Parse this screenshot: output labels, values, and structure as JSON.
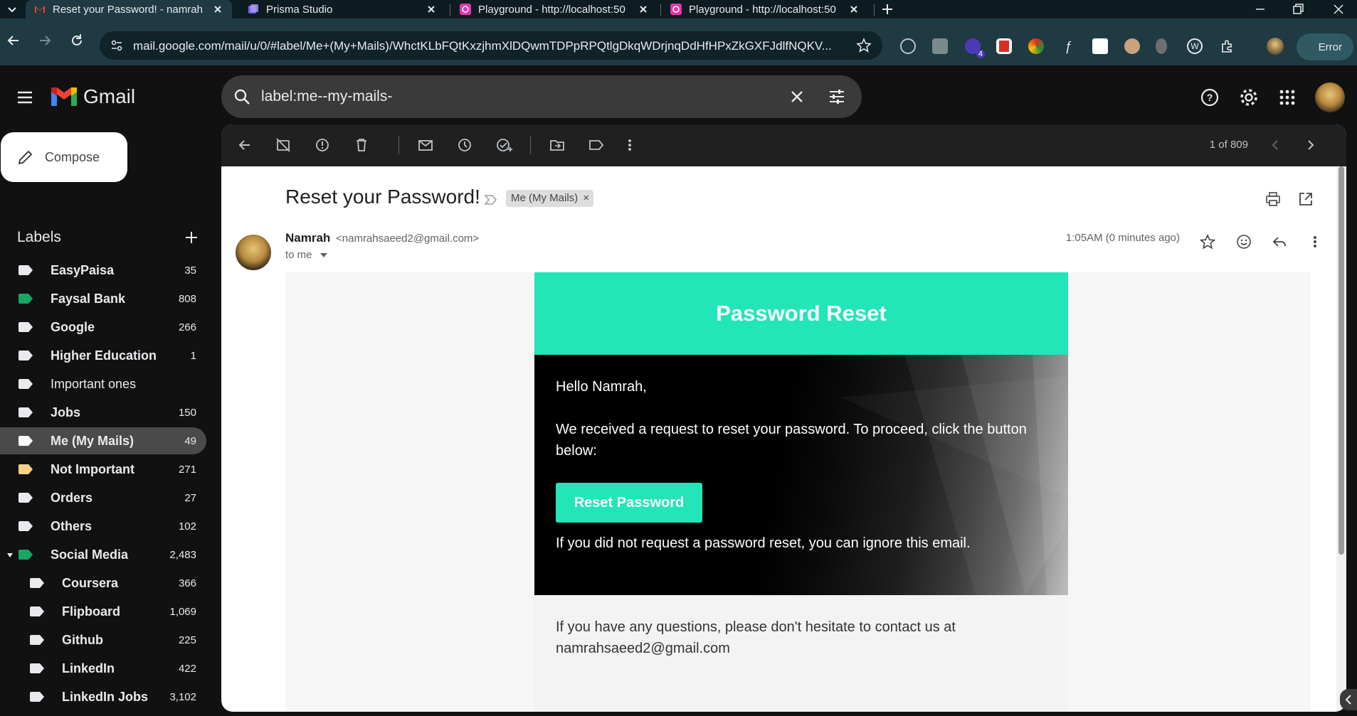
{
  "browser": {
    "tabs": [
      {
        "title": "Reset your Password! - namrah",
        "active": true
      },
      {
        "title": "Prisma Studio",
        "active": false
      },
      {
        "title": "Playground - http://localhost:50",
        "active": false
      },
      {
        "title": "Playground - http://localhost:50",
        "active": false
      }
    ],
    "url": "mail.google.com/mail/u/0/#label/Me+(My+Mails)/WhctKLbFQtKxzjhmXlDQwmTDPpRPQtlgDkqWDrjnqDdHfHPxZkGXFJdlfNQKV...",
    "extension_badge": "4",
    "profile_button": "Error"
  },
  "gmail": {
    "logo_text": "Gmail",
    "search_query": "label:me--my-mails-",
    "compose_label": "Compose",
    "labels_title": "Labels",
    "labels": [
      {
        "name": "EasyPaisa",
        "count": "35",
        "color": "#e8eaed",
        "bold": true
      },
      {
        "name": "Faysal Bank",
        "count": "808",
        "color": "#16a765",
        "bold": true
      },
      {
        "name": "Google",
        "count": "266",
        "color": "#e8eaed",
        "bold": true
      },
      {
        "name": "Higher Education",
        "count": "1",
        "color": "#e8eaed",
        "bold": true
      },
      {
        "name": "Important ones",
        "count": "",
        "color": "#e8eaed",
        "bold": false
      },
      {
        "name": "Jobs",
        "count": "150",
        "color": "#e8eaed",
        "bold": true
      },
      {
        "name": "Me (My Mails)",
        "count": "49",
        "color": "#ffffff",
        "bold": true,
        "selected": true
      },
      {
        "name": "Not Important",
        "count": "271",
        "color": "#ffd08a",
        "bold": true
      },
      {
        "name": "Orders",
        "count": "27",
        "color": "#e8eaed",
        "bold": true
      },
      {
        "name": "Others",
        "count": "102",
        "color": "#e8eaed",
        "bold": true
      },
      {
        "name": "Social Media",
        "count": "2,483",
        "color": "#16a765",
        "bold": true,
        "expanded": true
      },
      {
        "name": "Coursera",
        "count": "366",
        "color": "#e8eaed",
        "bold": true,
        "child": true
      },
      {
        "name": "Flipboard",
        "count": "1,069",
        "color": "#e8eaed",
        "bold": true,
        "child": true
      },
      {
        "name": "Github",
        "count": "225",
        "color": "#e8eaed",
        "bold": true,
        "child": true
      },
      {
        "name": "LinkedIn",
        "count": "422",
        "color": "#e8eaed",
        "bold": true,
        "child": true
      },
      {
        "name": "LinkedIn Jobs",
        "count": "3,102",
        "color": "#e8eaed",
        "bold": true,
        "child": true
      }
    ],
    "pager": "1 of 809",
    "message": {
      "subject": "Reset your Password!",
      "label_chip": "Me (My Mails)",
      "sender_name": "Namrah",
      "sender_email": "<namrahsaeed2@gmail.com>",
      "recipient": "to me",
      "time": "1:05AM (0 minutes ago)"
    },
    "email_content": {
      "header": "Password Reset",
      "greeting": "Hello Namrah,",
      "paragraph": "We received a request to reset your password. To proceed, click the button below:",
      "button": "Reset Password",
      "ignore_note": "If you did not request a password reset, you can ignore this email.",
      "footer": "If you have any questions, please don't hesitate to contact us at namrahsaeed2@gmail.com"
    }
  }
}
